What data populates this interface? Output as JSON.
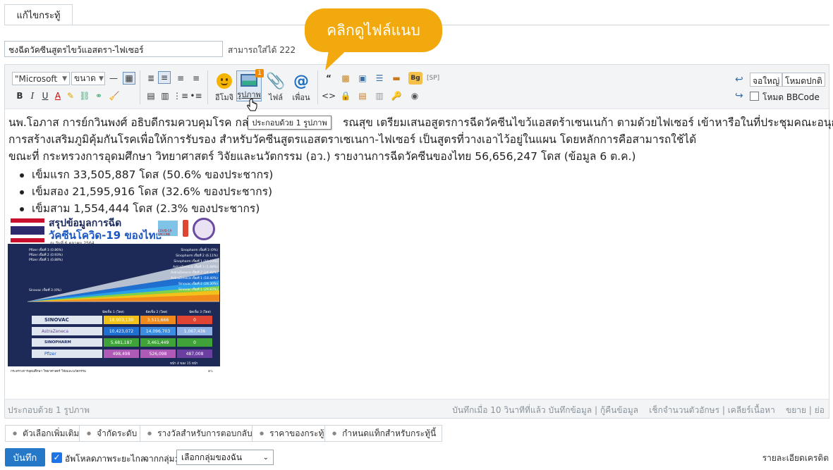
{
  "tab": {
    "label": "แก้ไขกระทู้"
  },
  "title_field": {
    "value": "ชงฉีดวัคซีนสูตรไขว้แอสตรา-ไฟเซอร์",
    "hint": "สามารถใส่ได้ 222"
  },
  "callout": {
    "text": "คลิกดูไฟล์แนบ"
  },
  "toolbar": {
    "font_select": "\"Microsoft",
    "size_select": "ขนาด",
    "emoji_label": "อีโมจิ",
    "image_label": "รูปภาพ",
    "image_badge": "1",
    "file_label": "ไฟล์",
    "mention_label": "เพื่อน",
    "sp_label": "[SP]",
    "bg_label": "Bg",
    "fullscreen_label": "จอใหญ่",
    "normal_mode_label": "โหมดปกติ",
    "bbcode_label": "โหมด BBCode",
    "image_tooltip": "ประกอบด้วย 1 รูปภาพ"
  },
  "content": {
    "para1": "นพ.โอภาส การย์กวินพงศ์ อธิบดีกรมควบคุมโรค กล่า",
    "para1_rest": "รณสุข เตรียมเสนอสูตรการฉีดวัคซีนไขว้แอสตร้าเซนเนก้า ตามด้วยไฟเซอร์ เข้าหารือในที่ประชุมคณะอนุกรรม",
    "para2": "การสร้างเสริมภูมิคุ้มกันโรคเพื่อให้การรับรอง สำหรับวัคซีนสูตรแอสตราเซเนกา-ไฟเซอร์ เป็นสูตรที่วางเอาไว้อยู่ในแผน โดยหลักการคือสามารถใช้ได้",
    "para3": "ขณะที่ กระทรวงการอุดมศึกษา วิทยาศาสตร์ วิจัยและนวัตกรรม (อว.) รายงานการฉีดวัคซีนของไทย  56,656,247 โดส (ข้อมูล 6 ต.ค.)",
    "bullets": [
      "เข็มแรก 33,505,887 โดส (50.6% ของประชากร)",
      "เข็มสอง 21,595,916 โดส (32.6% ของประชากร)",
      "เข็มสาม 1,554,444 โดส (2.3% ของประชากร)"
    ]
  },
  "infographic": {
    "title1": "สรุปข้อมูลการฉีด",
    "title2": "วัคซีนโควิด-19 ของไทย",
    "date": "ณ วันที่ 6 ตุลาคม 2564",
    "badge": "COVID-19 VACCINE",
    "series_left": [
      "Pfizer เข็มที่ 3 (0.86%)",
      "Pfizer เข็มที่ 2 (0.93%)",
      "Pfizer เข็มที่ 1 (0.88%)"
    ],
    "series_right": [
      "Sinopharm เข็มที่ 3 (0%)",
      "Sinopharm เข็มที่ 2 (6.11%)",
      "Sinopharm เข็มที่ 1 (10.03%)",
      "AstraZeneca เข็มที่ 3 (1.88%)",
      "AstraZeneca เข็มที่ 2 (24.88%)",
      "AstraZeneca เข็มที่ 1 (18.40%)",
      "Sinovac เข็มที่ 2 (28.30%)",
      "Sinovac เข็มที่ 1 (29.83%)"
    ],
    "sinovac3": "Sinovac เข็มที่ 3 (0%)",
    "col_headers": [
      "ฉีดเข็ม 1 (โดส)",
      "ฉีดเข็ม 2 (โดส)",
      "ฉีดเข็ม 3 (โดส)"
    ],
    "rows": [
      {
        "name": "SINOVAC",
        "v": [
          "18,903,130",
          "3,511,666",
          "0"
        ]
      },
      {
        "name": "AstraZeneca",
        "v": [
          "10,423,072",
          "14,096,703",
          "1,067,436"
        ]
      },
      {
        "name": "SINOPHARM",
        "v": [
          "5,681,187",
          "3,461,449",
          "0"
        ]
      },
      {
        "name": "Pfizer",
        "v": [
          "498,498",
          "526,098",
          "487,008"
        ]
      }
    ],
    "footer_org": "กระทรวงการอุดมศึกษา วิทยาศาสตร์ วิจัยและนวัตกรรม",
    "footer_page": "หน้า 4 ของ 15 หน้า",
    "footer_right": "อว."
  },
  "statusbar": {
    "left": "ประกอบด้วย 1 รูปภาพ",
    "right": "บันทึกเมื่อ 10 วินาทีที่แล้ว บันทึกข้อมูล | กู้คืนข้อมูล    เช็กจำนวนตัวอักษร | เคลียร์เนื้อหา    ขยาย | ย่อ"
  },
  "options": [
    "ตัวเลือกเพิ่มเติม",
    "จำกัดระดับ",
    "รางวัลสำหรับการตอบกลับ",
    "ราคาของกระทู้",
    "กำหนดแท็กสำหรับกระทู้นี้"
  ],
  "footer": {
    "save": "บันทึก",
    "remote_upload": "อัพโหลดภาพระยะไกล",
    "from_group": "จากกลุ่ม:",
    "group_select": "เลือกกลุ่มของฉัน",
    "credit_details": "รายละเอียดเครดิต"
  }
}
